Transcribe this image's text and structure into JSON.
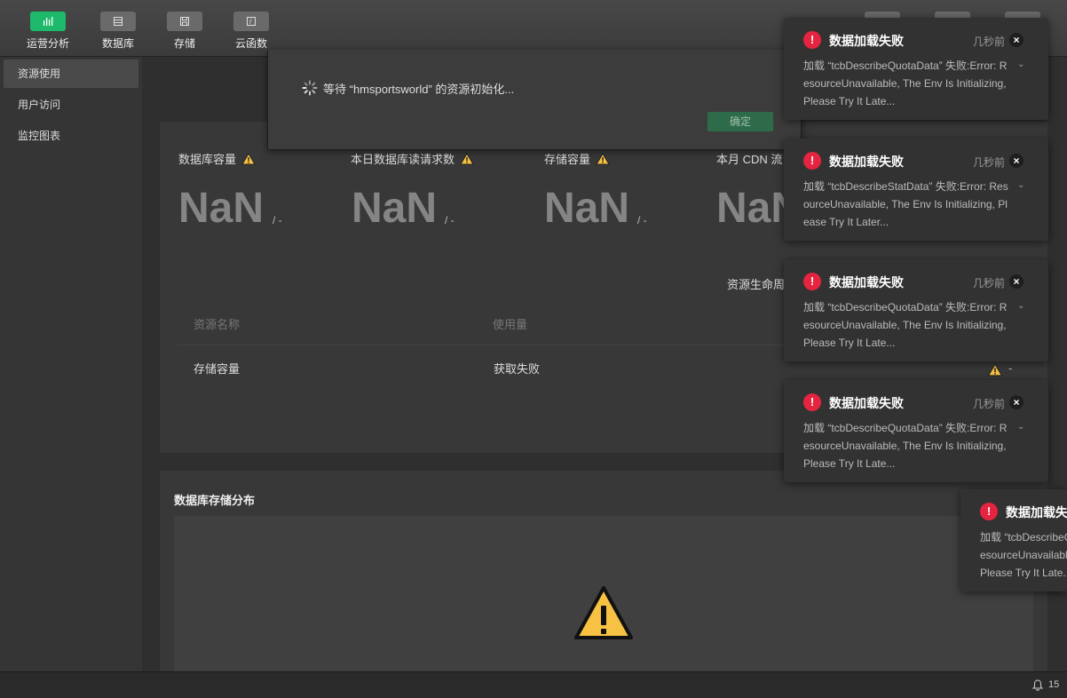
{
  "toolbar": {
    "items": [
      {
        "label": "运营分析",
        "icon": "bar-chart-icon",
        "active": true
      },
      {
        "label": "数据库",
        "icon": "database-icon",
        "active": false
      },
      {
        "label": "存储",
        "icon": "save-disk-icon",
        "active": false
      },
      {
        "label": "云函数",
        "icon": "function-icon",
        "active": false
      }
    ]
  },
  "sidebar": {
    "items": [
      {
        "label": "资源使用",
        "active": true
      },
      {
        "label": "用户访问",
        "active": false
      },
      {
        "label": "监控图表",
        "active": false
      }
    ]
  },
  "dialog": {
    "message": "等待 “hmsportsworld” 的资源初始化...",
    "confirm_label": "确定"
  },
  "stats": [
    {
      "label": "数据库容量",
      "value": "NaN",
      "unit": "/ -"
    },
    {
      "label": "本日数据库读请求数",
      "value": "NaN",
      "unit": "/ -"
    },
    {
      "label": "存储容量",
      "value": "NaN",
      "unit": "/ -"
    },
    {
      "label": "本月 CDN 流",
      "value": "NaN",
      "unit": ""
    }
  ],
  "lifecycle_label": "资源生命周",
  "table": {
    "headers": [
      "资源名称",
      "使用量"
    ],
    "rows": [
      {
        "name": "存储容量",
        "usage": "获取失败",
        "status": "-"
      }
    ]
  },
  "db_distribution": {
    "title": "数据库存储分布"
  },
  "notifications": [
    {
      "title": "数据加载失败",
      "time": "几秒前",
      "body": "加载 “tcbDescribeQuotaData” 失败:Error: ResourceUnavailable, The Env Is Initializing, Please Try It Late..."
    },
    {
      "title": "数据加载失败",
      "time": "几秒前",
      "body": "加载 “tcbDescribeStatData” 失败:Error: ResourceUnavailable, The Env Is Initializing, Please Try It Later..."
    },
    {
      "title": "数据加载失败",
      "time": "几秒前",
      "body": "加载 “tcbDescribeQuotaData” 失败:Error: ResourceUnavailable, The Env Is Initializing, Please Try It Late..."
    },
    {
      "title": "数据加载失败",
      "time": "几秒前",
      "body": "加载 “tcbDescribeQuotaData” 失败:Error: ResourceUnavailable, The Env Is Initializing, Please Try It Late..."
    },
    {
      "title": "数据加载失",
      "time": "",
      "body": "加载 “tcbDescribeQuotaData” 失败:Error: ResourceUnavailable, The Env Is Initializing, Please Try It Late..."
    }
  ],
  "statusbar": {
    "notification_count": "15"
  },
  "colors": {
    "accent": "#1fb96c",
    "error": "#e5243f",
    "warning": "#f7c244"
  }
}
